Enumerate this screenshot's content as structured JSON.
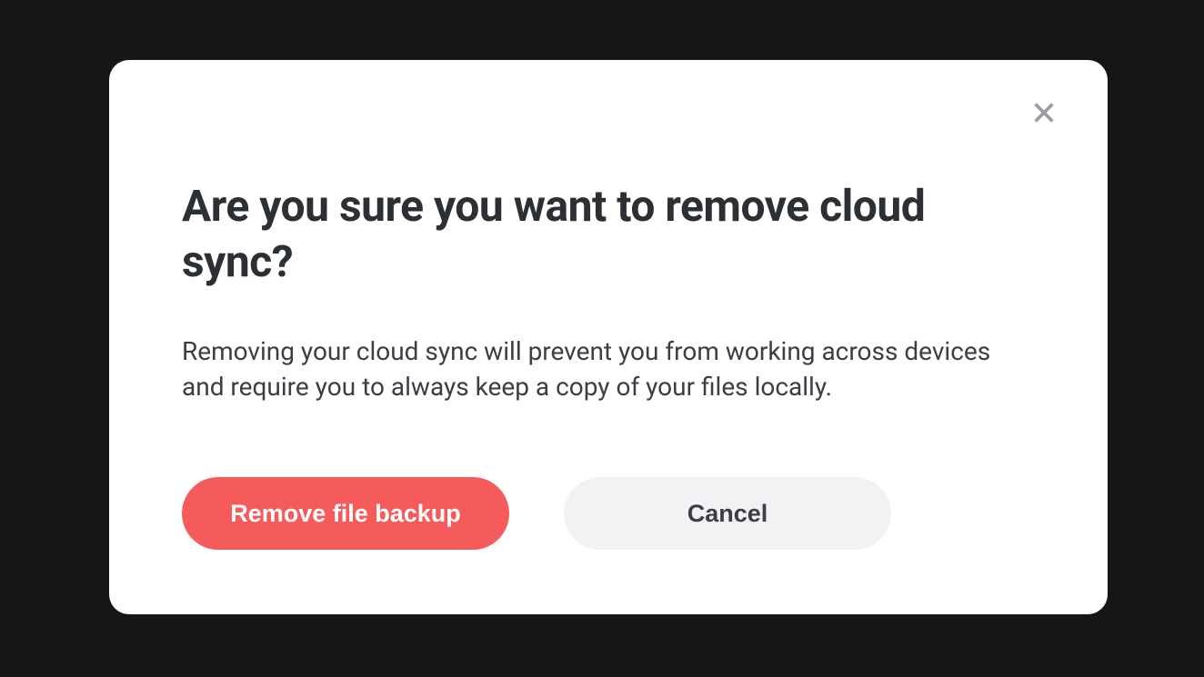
{
  "modal": {
    "title": "Are you sure you want to remove cloud sync?",
    "body": "Removing your cloud sync will prevent you from working across devices and require you to always keep a copy of your files locally.",
    "primary_button": "Remove file backup",
    "secondary_button": "Cancel"
  },
  "colors": {
    "background": "#141618",
    "modal_bg": "#ffffff",
    "primary_button": "#f55b5b",
    "secondary_button": "#f2f2f4",
    "text_dark": "#2c2f34",
    "close_icon": "#9a9da3"
  }
}
